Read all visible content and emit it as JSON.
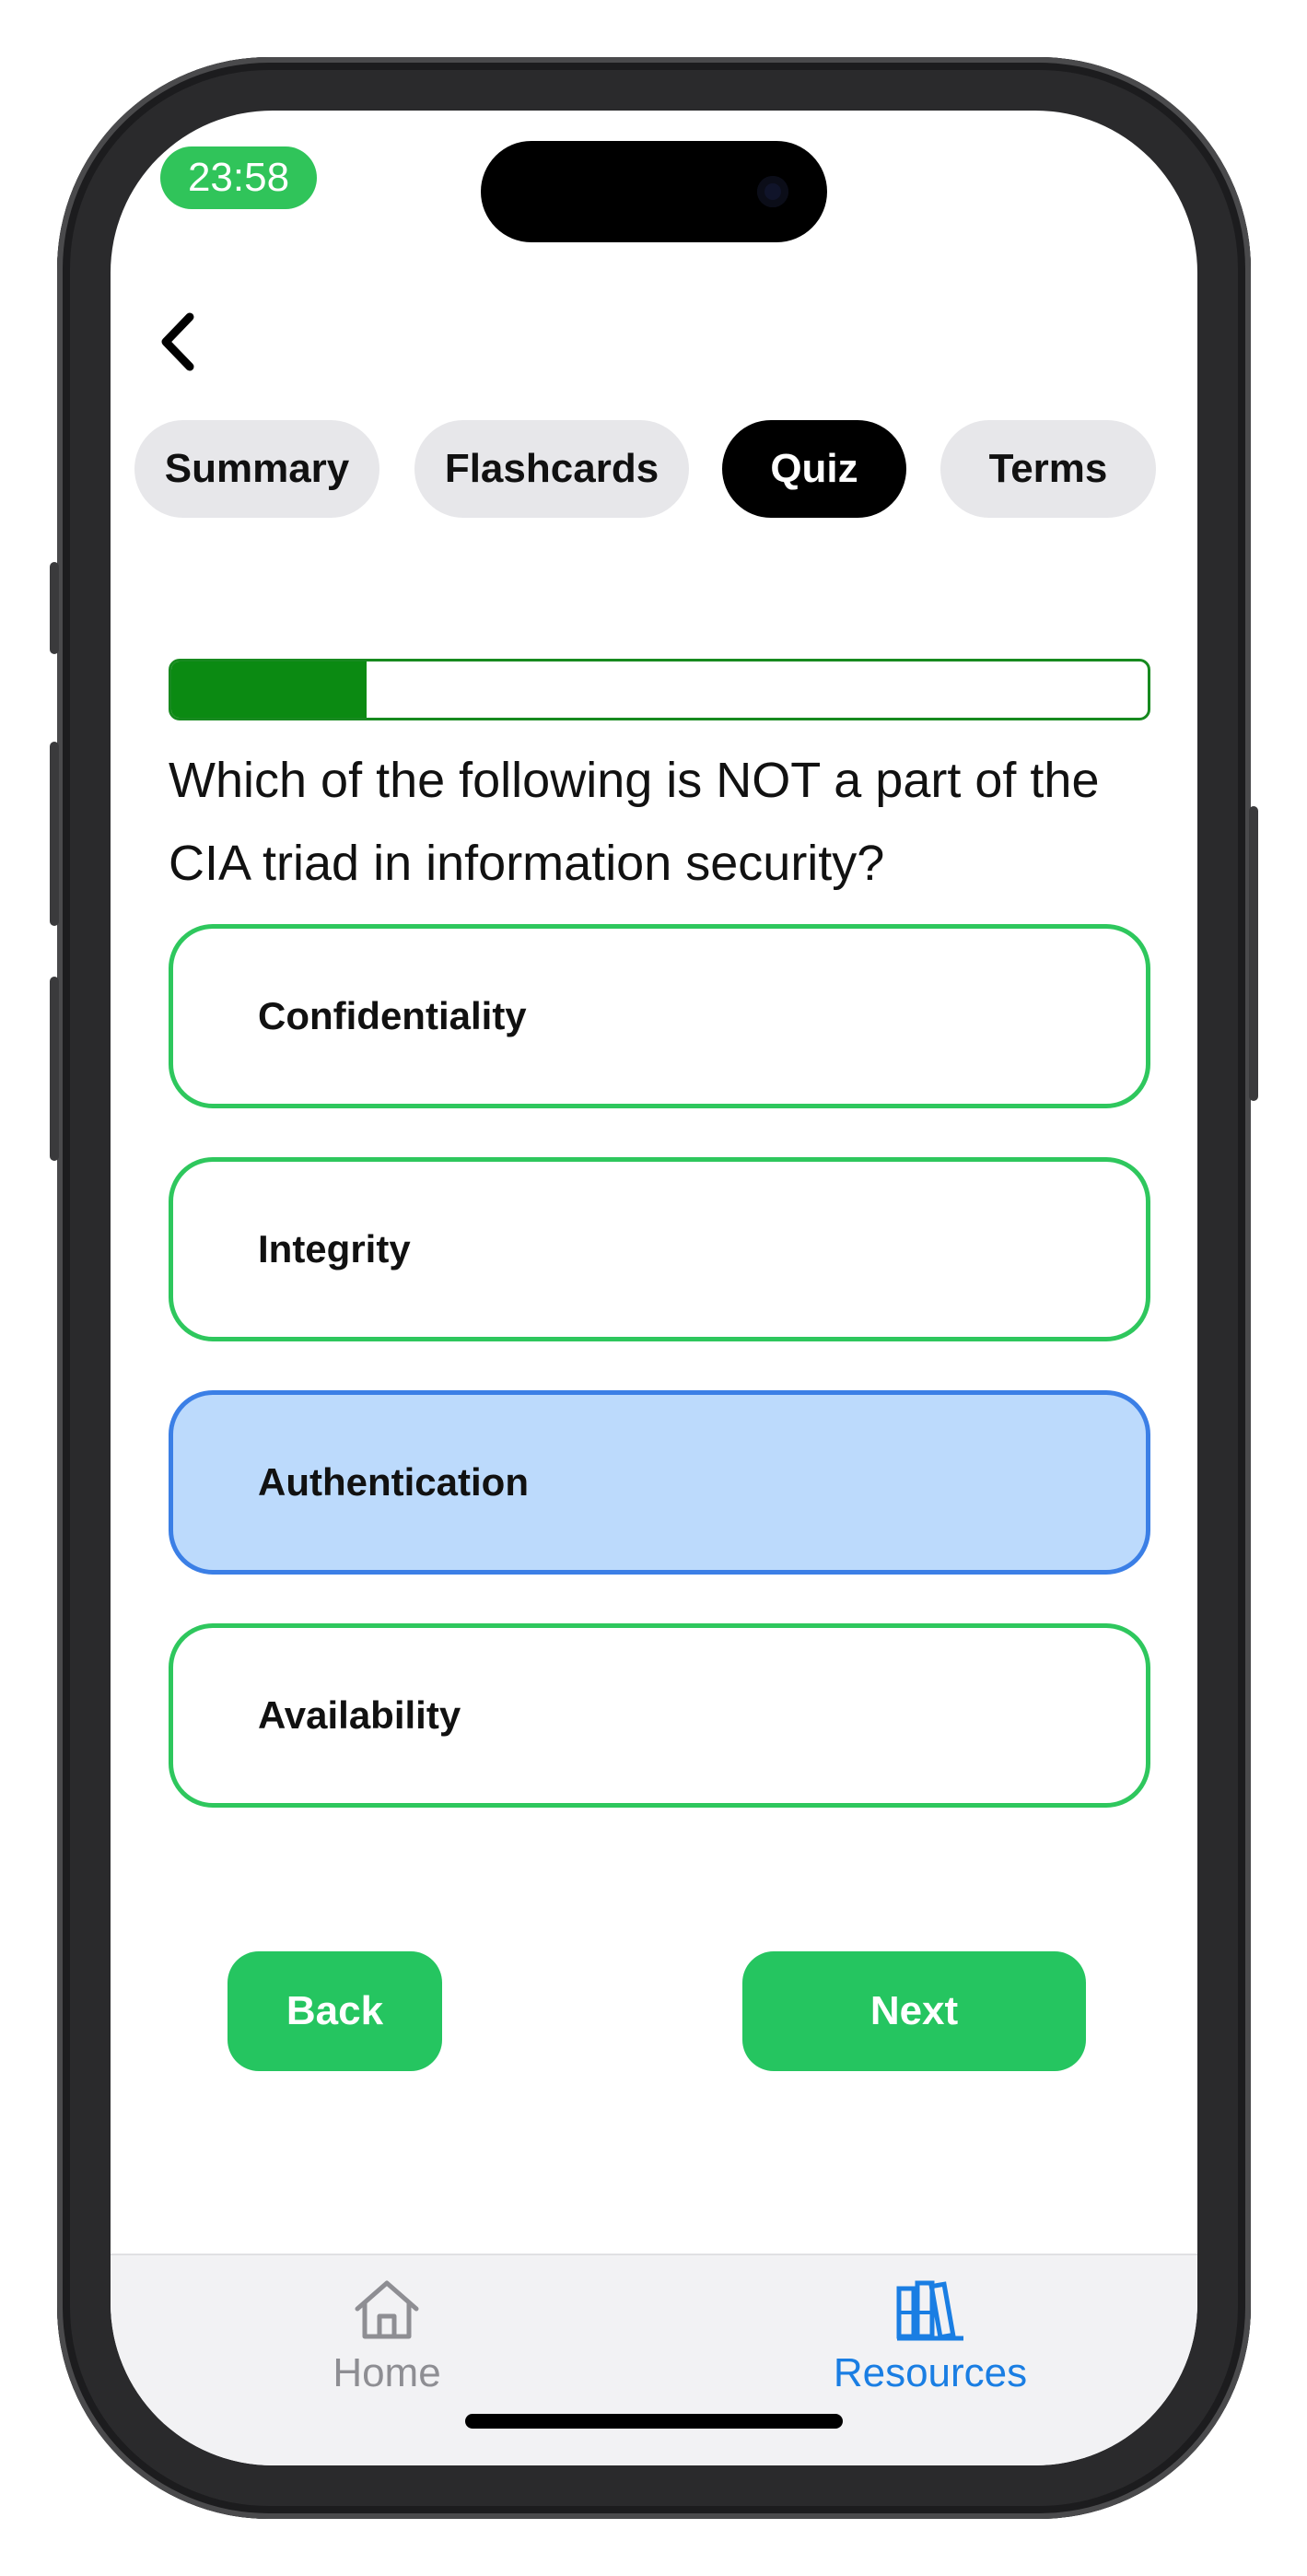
{
  "status_bar": {
    "time": "23:58"
  },
  "nav": {
    "back_icon": "chevron-left-icon"
  },
  "tabs": [
    {
      "label": "Summary",
      "active": false
    },
    {
      "label": "Flashcards",
      "active": false
    },
    {
      "label": "Quiz",
      "active": true
    },
    {
      "label": "Terms",
      "active": false
    }
  ],
  "quiz": {
    "progress_fraction": 0.2,
    "question": "Which of the following is NOT a part of the CIA triad in information security?",
    "options": [
      {
        "label": "Confidentiality",
        "selected": false
      },
      {
        "label": "Integrity",
        "selected": false
      },
      {
        "label": "Authentication",
        "selected": true
      },
      {
        "label": "Availability",
        "selected": false
      }
    ],
    "back_label": "Back",
    "next_label": "Next"
  },
  "tabbar": {
    "items": [
      {
        "label": "Home",
        "icon": "house-icon",
        "active": false
      },
      {
        "label": "Resources",
        "icon": "books-icon",
        "active": true
      }
    ]
  },
  "colors": {
    "accent_green": "#25c560",
    "progress_green": "#0b8a12",
    "selected_fill": "#bcdafc",
    "selected_border": "#3b7fe6",
    "active_tab_blue": "#1a7ee3",
    "inactive_gray": "#8e8e93"
  }
}
